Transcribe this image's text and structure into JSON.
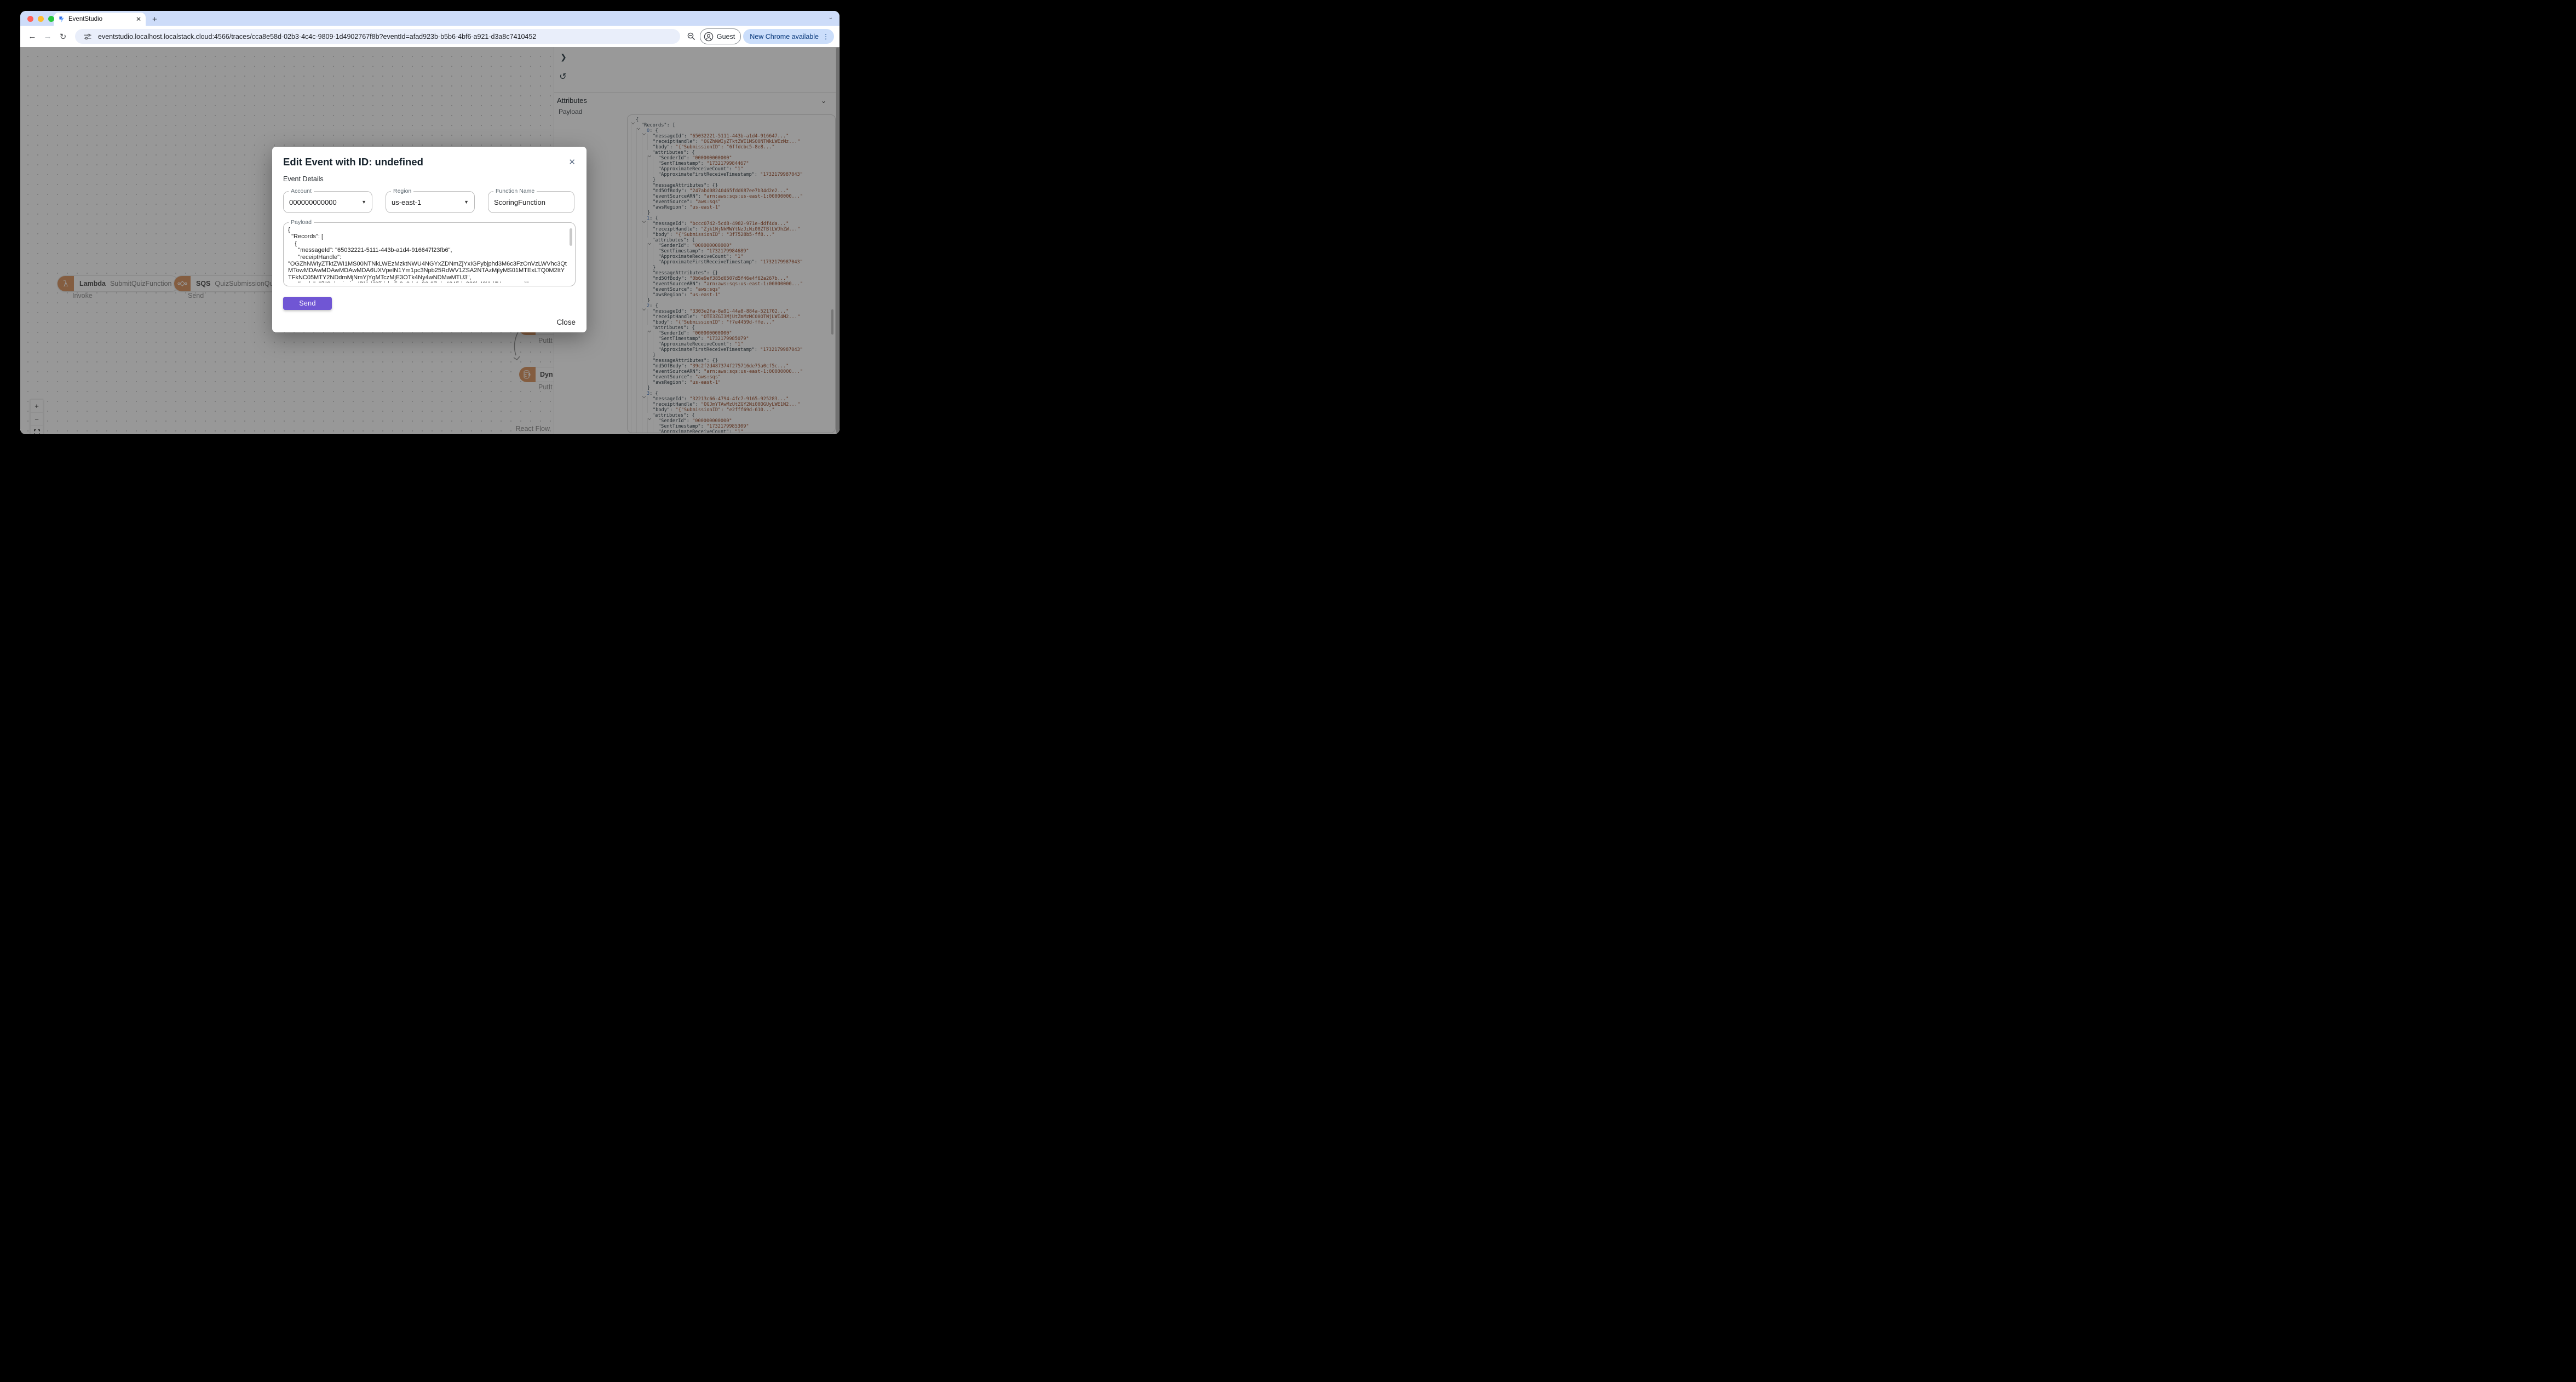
{
  "browser": {
    "tab": {
      "title": "EventStudio",
      "close_glyph": "✕",
      "new_tab_glyph": "+",
      "strip_chevron_glyph": "⌄"
    },
    "toolbar": {
      "back_glyph": "←",
      "forward_glyph": "→",
      "reload_glyph": "↻",
      "url": "eventstudio.localhost.localstack.cloud:4566/traces/cca8e58d-02b3-4c4c-9809-1d4902767f8b?eventId=afad923b-b5b6-4bf6-a921-d3a8c7410452",
      "profile_label": "Guest",
      "update_pill_label": "New Chrome available",
      "menu_glyph": "⋮"
    }
  },
  "modal": {
    "title": "Edit Event with ID: undefined",
    "close_glyph": "✕",
    "section_label": "Event Details",
    "fields": {
      "account": {
        "label": "Account",
        "value": "000000000000"
      },
      "region": {
        "label": "Region",
        "value": "us-east-1"
      },
      "function_name": {
        "label": "Function Name",
        "value": "ScoringFunction"
      },
      "payload": {
        "label": "Payload",
        "value": "{\n  \"Records\": [\n    {\n      \"messageId\": \"65032221-5111-443b-a1d4-916647f23fb6\",\n      \"receiptHandle\": \"OGZhNWIyZTktZWI1MS00NTNkLWEzMzktNWU4NGYxZDNmZjYxIGFybjphd3M6c3FzOnVzLWVhc3QtMTowMDAwMDAwMDAwMDA6UXVpelN1Ym1pc3Npb25RdWV1ZSA2NTAzMjIyMS01MTExLTQ0M2ItYTFkNC05MTY2NDdmMjNmYjYgMTczMjE3OTk4Ny4wNDMwMTU3\",\n      \"body\": \"{\\\"SubmissionID\\\": \\\"6ffdcbc5-8e8d-4a82-97eb-4245de222b48\\\", \\\"Username\\\": \\\"cloudRookie\\\", \\\"QuizID\\\": \\\"adorable-"
      }
    },
    "send_label": "Send",
    "close_label": "Close"
  },
  "canvas": {
    "nodes": [
      {
        "service": "Lambda",
        "resource": "SubmitQuizFunction",
        "edge_label": "Invoke"
      },
      {
        "service": "SQS",
        "resource": "QuizSubmissionQueue",
        "edge_label": "Send"
      }
    ],
    "edge_arrow_glyph": "→",
    "partial_nodes": [
      {
        "service": "",
        "edge_label": "PutIt"
      },
      {
        "service": "Dyn",
        "edge_label": "PutIt"
      }
    ],
    "controls": {
      "zoom_in": "+",
      "zoom_out": "−"
    },
    "attribution": "React Flow"
  },
  "sidebar": {
    "collapse_glyph": "❯",
    "reset_glyph": "↺",
    "attributes_label": "Attributes",
    "attributes_chevron_glyph": "⌄",
    "payload_label": "Payload",
    "payload_tree": {
      "root_key": "Records",
      "records": [
        {
          "messageId": "65032221-5111-443b-a1d4-916647...",
          "receiptHandle": "OGZhNWIyZTktZWI1MS00NTNkLWEzMz...",
          "body": "{\"SubmissionID\": \"6ffdcbc5-8e8...",
          "attributes": {
            "SenderId": "000000000000",
            "SentTimestamp": "1732179984467",
            "ApproximateReceiveCount": "1",
            "ApproximateFirstReceiveTimestamp": "1732179987043"
          },
          "messageAttributes": "{}",
          "md5OfBody": "247abd08240465fdd687ee7b34d2e2...",
          "eventSourceARN": "arn:aws:sqs:us-east-1:00000000...",
          "eventSource": "aws:sqs",
          "awsRegion": "us-east-1"
        },
        {
          "messageId": "bccc0742-5cd8-4982-971e-ddf4da...",
          "receiptHandle": "Zjk1NjNkMWYtNzJiNi00ZTBlLWJhZW...",
          "body": "{\"SubmissionID\": \"3f7528b5-ff8...",
          "attributes": {
            "SenderId": "000000000000",
            "SentTimestamp": "1732179984689",
            "ApproximateReceiveCount": "1",
            "ApproximateFirstReceiveTimestamp": "1732179987043"
          },
          "messageAttributes": "{}",
          "md5OfBody": "0b6e9ef385d0507d5f46e4f62a267b...",
          "eventSourceARN": "arn:aws:sqs:us-east-1:00000000...",
          "eventSource": "aws:sqs",
          "awsRegion": "us-east-1"
        },
        {
          "messageId": "3303e2fa-8a91-44a8-884a-521702...",
          "receiptHandle": "OTE3ZGI3MjUtZmMzMC00OTNjLWI4M2...",
          "body": "{\"SubmissionID\": \"f7e4459d-ffe...",
          "attributes": {
            "SenderId": "000000000000",
            "SentTimestamp": "1732179985079",
            "ApproximateReceiveCount": "1",
            "ApproximateFirstReceiveTimestamp": "1732179987043"
          },
          "messageAttributes": "{}",
          "md5OfBody": "39c2f2d487374f275716de75a0cf5c...",
          "eventSourceARN": "arn:aws:sqs:us-east-1:00000000...",
          "eventSource": "aws:sqs",
          "awsRegion": "us-east-1"
        },
        {
          "messageId": "32213c66-4794-4fc7-9165-925283...",
          "receiptHandle": "OGJmYTAwMzUtZGY2Ni00OGUyLWE1N2...",
          "body": "{\"SubmissionID\": \"e2fff69d-610...",
          "attributes": {
            "SenderId": "000000000000",
            "SentTimestamp": "1732179985309",
            "ApproximateReceiveCount": "1"
          }
        }
      ]
    }
  },
  "colors": {
    "send_button": "#7056d4",
    "node_accent": "#dd9c6b",
    "tab_strip": "#cddcf9",
    "update_pill_bg": "#cbdefb",
    "json_key": "#39464e",
    "json_value": "#9e5332",
    "json_index": "#4c7bbf"
  }
}
